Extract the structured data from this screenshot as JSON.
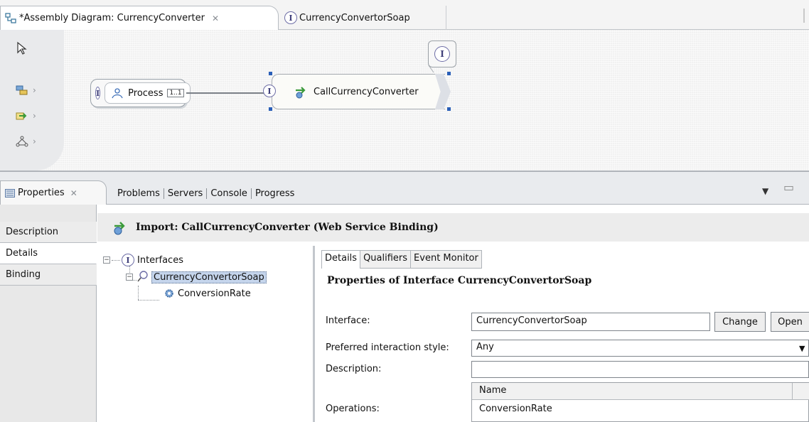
{
  "editor_tabs": [
    {
      "label": "*Assembly Diagram: CurrencyConverter",
      "active": true
    },
    {
      "label": "CurrencyConvertorSoap",
      "active": false
    }
  ],
  "diagram": {
    "process_label": "Process",
    "process_multiplicity": "1..1",
    "import_label": "CallCurrencyConverter",
    "interface_glyph": "I"
  },
  "views": {
    "active_tab": "Properties",
    "other_tabs": [
      "Problems",
      "Servers",
      "Console",
      "Progress"
    ]
  },
  "properties": {
    "sidebar": [
      "Description",
      "Details",
      "Binding"
    ],
    "header_title": "Import: CallCurrencyConverter (Web Service Binding)",
    "tree": {
      "root": "Interfaces",
      "interface": "CurrencyConvertorSoap",
      "operation": "ConversionRate"
    },
    "detail_tabs": [
      "Details",
      "Qualifiers",
      "Event Monitor"
    ],
    "detail_title": "Properties of Interface CurrencyConvertorSoap",
    "interface_label": "Interface:",
    "interface_value": "CurrencyConvertorSoap",
    "change_button": "Change",
    "open_button": "Open",
    "style_label": "Preferred interaction style:",
    "style_value": "Any",
    "description_label": "Description:",
    "description_value": "",
    "operations_label": "Operations:",
    "operations_column": "Name",
    "operations": [
      "ConversionRate"
    ]
  },
  "colors": {
    "selection": "#c5d5ec",
    "handle": "#2a5fb8",
    "interface_ring": "#6d6da6"
  }
}
